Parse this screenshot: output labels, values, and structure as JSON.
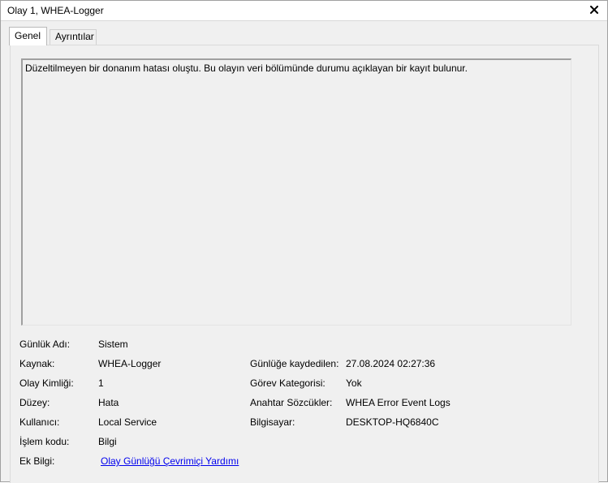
{
  "window": {
    "title": "Olay 1, WHEA-Logger",
    "close_icon": "close-icon"
  },
  "tabs": [
    {
      "label": "Genel",
      "active": true
    },
    {
      "label": "Ayrıntılar",
      "active": false
    }
  ],
  "description": "Düzeltilmeyen bir donanım hatası oluştu. Bu olayın veri bölümünde durumu açıklayan bir kayıt bulunur.",
  "fields": {
    "log_name": {
      "label": "Günlük Adı:",
      "value": "Sistem"
    },
    "source": {
      "label": "Kaynak:",
      "value": "WHEA-Logger"
    },
    "logged": {
      "label": "Günlüğe kaydedilen:",
      "value": "27.08.2024 02:27:36"
    },
    "event_id": {
      "label": "Olay Kimliği:",
      "value": "1"
    },
    "task_category": {
      "label": "Görev Kategorisi:",
      "value": "Yok"
    },
    "level": {
      "label": "Düzey:",
      "value": "Hata"
    },
    "keywords": {
      "label": "Anahtar Sözcükler:",
      "value": "WHEA Error Event Logs"
    },
    "user": {
      "label": "Kullanıcı:",
      "value": "Local Service"
    },
    "computer": {
      "label": "Bilgisayar:",
      "value": "DESKTOP-HQ6840C"
    },
    "opcode": {
      "label": "İşlem kodu:",
      "value": "Bilgi"
    },
    "more_info": {
      "label": "Ek Bilgi:",
      "link": "Olay Günlüğü Çevrimiçi Yardımı"
    }
  }
}
